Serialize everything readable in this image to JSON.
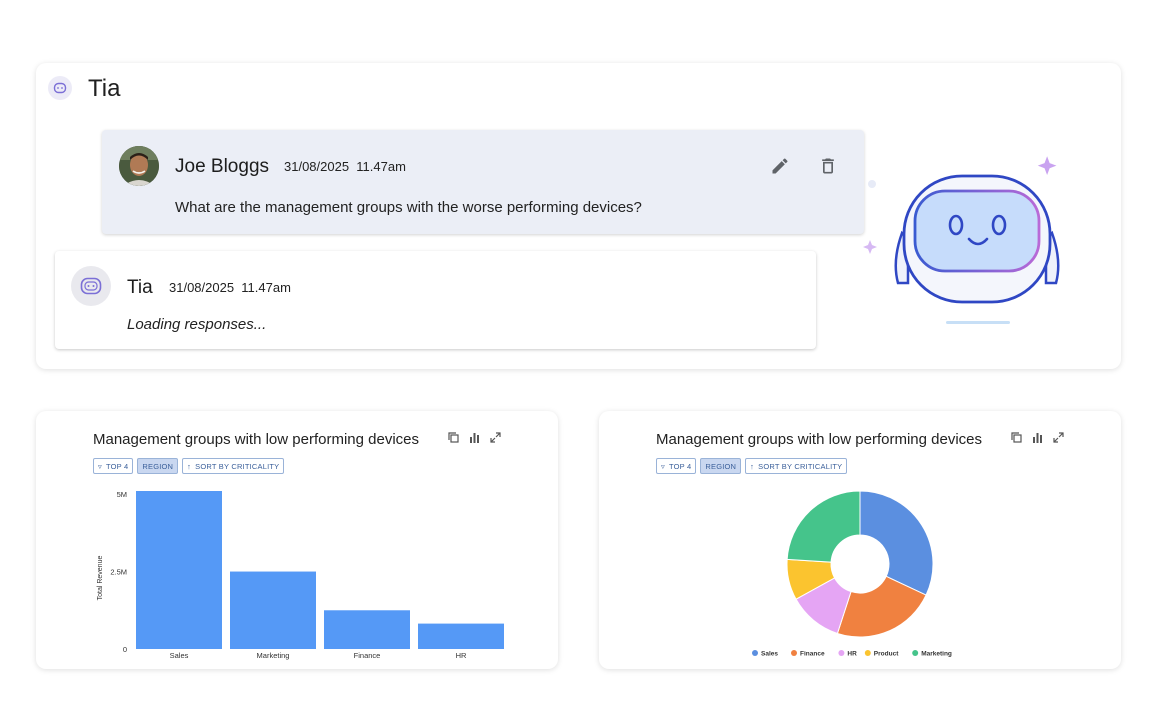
{
  "panel": {
    "title": "Tia"
  },
  "user_message": {
    "name": "Joe Bloggs",
    "timestamp": "31/08/2025  11.47am",
    "text": "What are the management groups with the worse performing devices?",
    "edit_icon": "pencil-icon",
    "delete_icon": "trash-icon"
  },
  "bot_message": {
    "name": "Tia",
    "timestamp": "31/08/2025  11.47am",
    "text": "Loading responses..."
  },
  "bar_card": {
    "title": "Management groups with low performing devices",
    "chips": [
      {
        "label": "TOP 4",
        "icon": "filter-icon",
        "active": false
      },
      {
        "label": "REGION",
        "icon": "",
        "active": true
      },
      {
        "label": "SORT BY CRITICALITY",
        "icon": "arrow-up-icon",
        "active": false
      }
    ]
  },
  "pie_card": {
    "title": "Management groups with low performing devices",
    "chips": [
      {
        "label": "TOP 4",
        "icon": "filter-icon",
        "active": false
      },
      {
        "label": "REGION",
        "icon": "",
        "active": true
      },
      {
        "label": "SORT BY CRITICALITY",
        "icon": "arrow-up-icon",
        "active": false
      }
    ]
  },
  "chart_data": [
    {
      "type": "bar",
      "categories": [
        "Sales",
        "Marketing",
        "Finance",
        "HR"
      ],
      "values": [
        5100000,
        2500000,
        1250000,
        820000
      ],
      "ylabel": "Total Revenue",
      "ylim": [
        0,
        5100000
      ],
      "yticks": [
        {
          "value": 0,
          "label": "0"
        },
        {
          "value": 2500000,
          "label": "2.5M"
        },
        {
          "value": 5000000,
          "label": "5M"
        }
      ],
      "color": "#5599f6",
      "grid": false
    },
    {
      "type": "pie",
      "donut": true,
      "categories": [
        "Sales",
        "Finance",
        "HR",
        "Product",
        "Marketing"
      ],
      "values": [
        32,
        23,
        12,
        9,
        24
      ],
      "colors": [
        "#5b8fe0",
        "#f08140",
        "#e5a5f4",
        "#fbc42f",
        "#45c48b"
      ],
      "legend_position": "bottom"
    }
  ]
}
